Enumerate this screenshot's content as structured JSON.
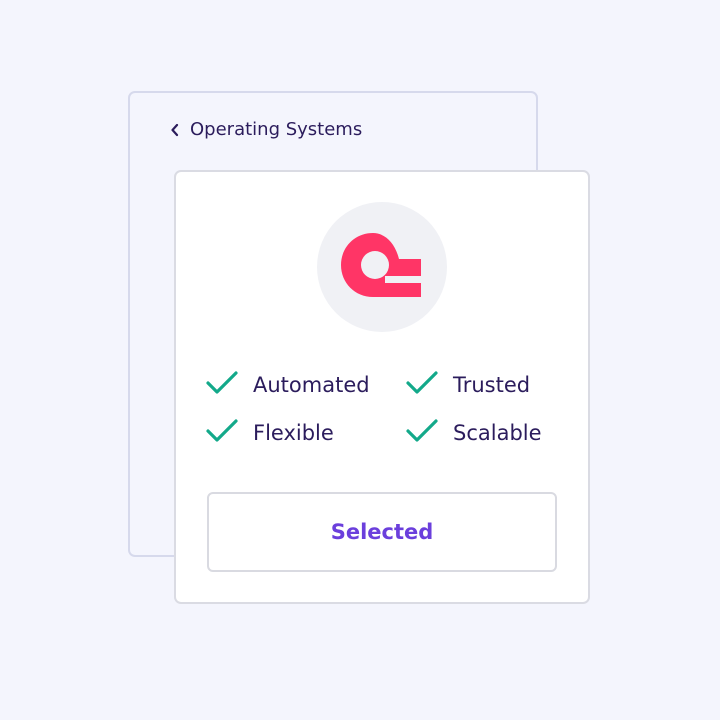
{
  "nav": {
    "back_label": "Operating Systems",
    "back_icon": "chevron-left-icon"
  },
  "card": {
    "logo_icon": "os-logo-icon",
    "features": [
      {
        "label": "Automated",
        "icon": "check-icon"
      },
      {
        "label": "Trusted",
        "icon": "check-icon"
      },
      {
        "label": "Flexible",
        "icon": "check-icon"
      },
      {
        "label": "Scalable",
        "icon": "check-icon"
      }
    ],
    "button_label": "Selected"
  },
  "colors": {
    "background": "#f4f5fd",
    "text": "#2b1c5c",
    "accent": "#6b3fdc",
    "check": "#13a98a",
    "logo": "#ff3566"
  }
}
